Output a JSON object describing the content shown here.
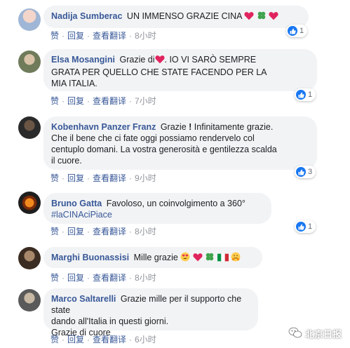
{
  "actions": {
    "like": "赞",
    "reply": "回复",
    "translate": "查看翻译",
    "sep": "·"
  },
  "comments": [
    {
      "author": "Nadija Sumberac",
      "text": "UN IMMENSO GRAZIE CINA",
      "time": "8小时",
      "likes": "1"
    },
    {
      "author": "Elsa Mosangini",
      "text_a": "Grazie di",
      "text_b": ". IO VI SARÒ SEMPRE",
      "line2": "GRATA PER QUELLO CHE STATE FACENDO PER LA",
      "line3": "MIA ITALIA.",
      "time": "7小时",
      "likes": "1"
    },
    {
      "author": "Kobenhavn Panzer Franz",
      "text_a": "Grazie",
      "text_b": "Infinitamente grazie.",
      "line2": "Che il bene che ci fate oggi possiamo rendervelo col",
      "line3": "centuplo domani. La vostra generosità e gentilezza scalda",
      "line4": "il cuore.",
      "time": "9小时",
      "likes": "3"
    },
    {
      "author": "Bruno Gatta",
      "text": "Favoloso, un coinvolgimento a 360°",
      "hashtag": "#laCINAciPiace",
      "time": "8小时",
      "likes": "1"
    },
    {
      "author": "Marghi Buonassisi",
      "text": "Mille grazie",
      "time": "8小时"
    },
    {
      "author": "Marco Saltarelli",
      "text": "Grazie mille per il supporto che state",
      "line2": "dando all'Italia in questi giorni.",
      "line3": "Grazie di cuore",
      "time": "6小时"
    }
  ],
  "watermark": {
    "text": "北京日报"
  },
  "colors": {
    "link": "#385898",
    "bubble": "#f2f3f5",
    "like": "#1877f2",
    "heart": "#e0245e",
    "clover": "#3fa34d"
  },
  "icons": [
    "heart-icon",
    "clover-icon",
    "like-icon",
    "heart-eyes-icon",
    "italy-flag-icon",
    "hugging-icon"
  ]
}
